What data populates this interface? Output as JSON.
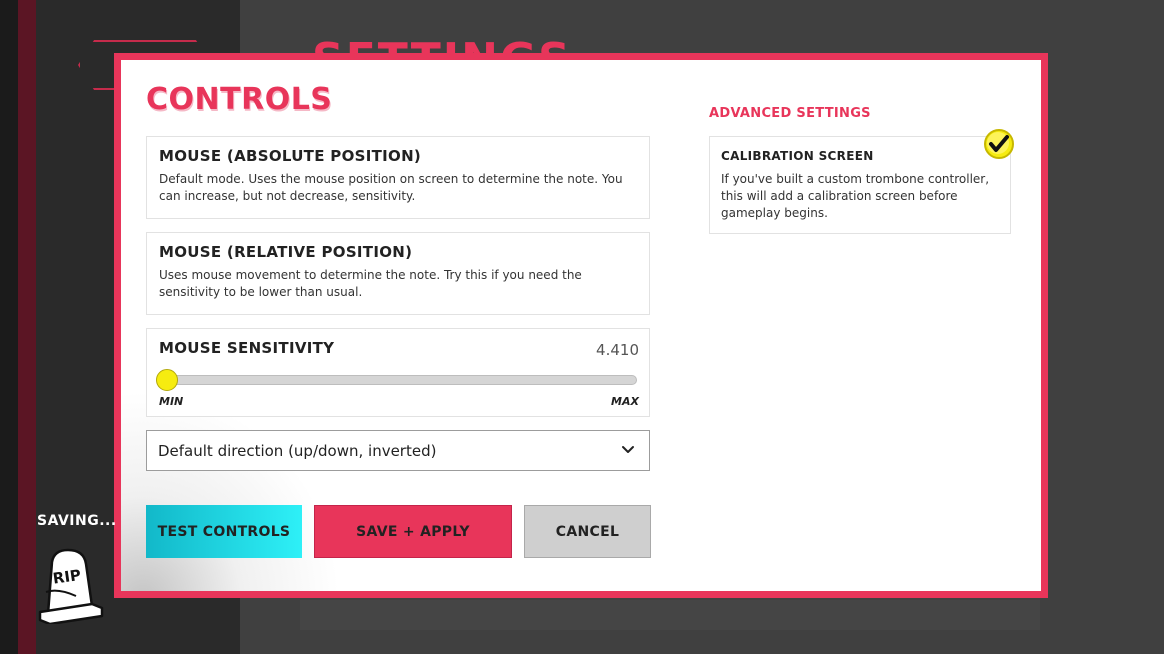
{
  "background": {
    "title": "SETTINGS"
  },
  "modal": {
    "title": "CONTROLS",
    "options": [
      {
        "title": "MOUSE (ABSOLUTE POSITION)",
        "description": "Default mode. Uses the mouse position on screen to determine the note. You can increase, but not decrease, sensitivity."
      },
      {
        "title": "MOUSE (RELATIVE POSITION)",
        "description": "Uses mouse movement to determine the note. Try this if you need the sensitivity to be lower than usual."
      }
    ],
    "sensitivity": {
      "label": "MOUSE SENSITIVITY",
      "value": "4.410",
      "slider_fraction": 0.0,
      "min_label": "MIN",
      "max_label": "MAX"
    },
    "direction_select": {
      "selected": "Default direction (up/down, inverted)"
    },
    "buttons": {
      "test": "TEST CONTROLS",
      "save": "SAVE + APPLY",
      "cancel": "CANCEL"
    },
    "advanced": {
      "heading": "ADVANCED SETTINGS",
      "calibration": {
        "title": "CALIBRATION SCREEN",
        "description": "If you've built a custom trombone controller, this will add a calibration screen before gameplay begins.",
        "checked": true
      }
    }
  },
  "status": {
    "saving_text": "SAVING...",
    "tombstone_text": "RIP"
  },
  "colors": {
    "accent": "#e8355a",
    "test_button": "#1cd6e3",
    "slider_thumb": "#f6ec10",
    "checkbox": "#f6ec10"
  },
  "icons": {
    "dropdown": "chevron-down-icon",
    "checkbox": "checkmark-icon",
    "saving": "tombstone-icon"
  }
}
